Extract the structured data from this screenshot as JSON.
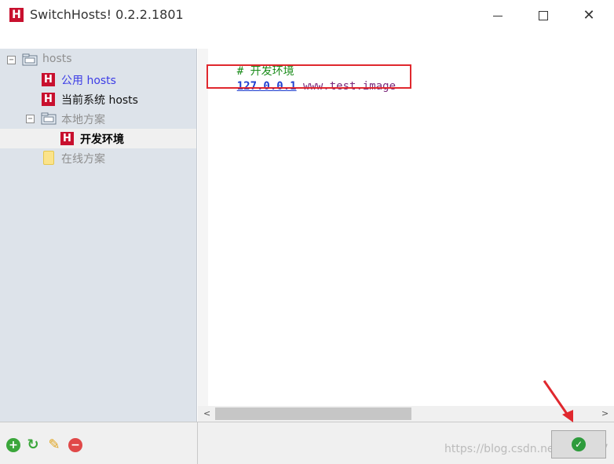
{
  "window": {
    "title": "SwitchHosts! 0.2.2.1801",
    "app_icon_letter": "H",
    "minimize": "—",
    "close": "✕"
  },
  "sidebar": {
    "items": [
      {
        "label": "hosts",
        "expander": "−"
      },
      {
        "label": "公用 hosts",
        "icon_letter": "H"
      },
      {
        "label": "当前系统 hosts",
        "icon_letter": "H"
      },
      {
        "label": "本地方案",
        "expander": "−"
      },
      {
        "label": "开发环境",
        "icon_letter": "H"
      },
      {
        "label": "在线方案"
      }
    ]
  },
  "editor": {
    "lines": [
      {
        "comment": "# 开发环境"
      },
      {
        "ip": "127.0.0.1",
        "domain": "www.test.image"
      }
    ]
  },
  "scrollbar": {
    "left_arrow": "<",
    "right_arrow": ">"
  },
  "toolbar": {
    "add_icon": "+",
    "refresh_icon": "↻",
    "edit_icon": "✎",
    "remove_icon": "−",
    "apply_icon": "✓"
  },
  "watermark": "https://blog.csdn.net/GuiSu97",
  "colors": {
    "brand_red": "#c8102e",
    "comment_green": "#1a8c1a",
    "ip_blue": "#1f3fd0",
    "domain_purple": "#7c2a7c",
    "highlight_red": "#e0282e",
    "sidebar_bg": "#dde3ea"
  }
}
